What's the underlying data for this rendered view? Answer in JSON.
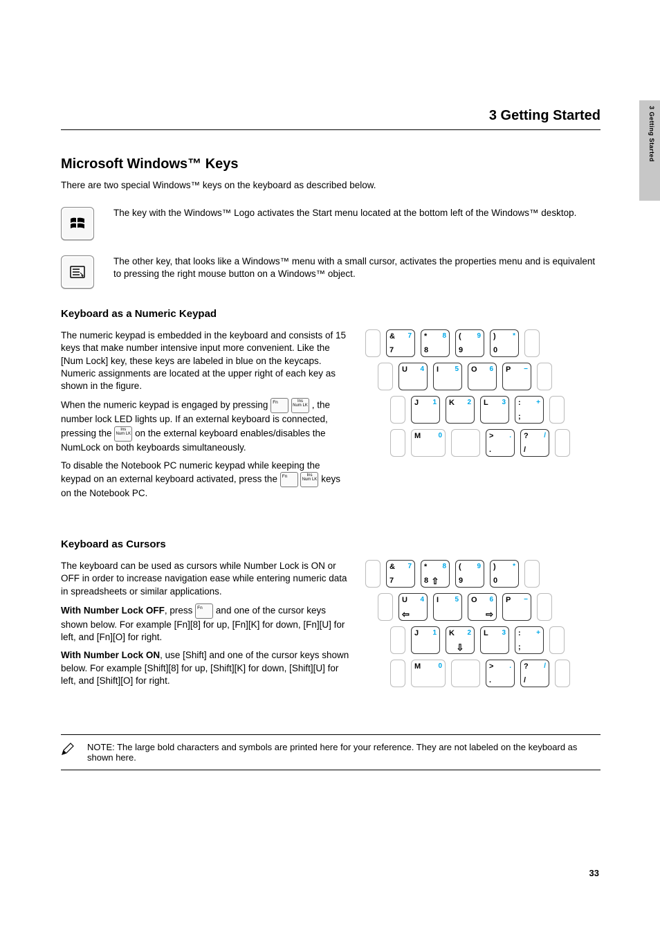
{
  "page_header": "3   Getting Started",
  "side_tab": "3   Getting Started",
  "page_number": "33",
  "winmenu": {
    "title": "Microsoft Windows™ Keys",
    "intro": "There are two special Windows™ keys on the keyboard as described below.",
    "items": [
      {
        "icon": "windows-logo-key",
        "text": "The key with the Windows™ Logo activates the Start menu located at the bottom left of the Windows™ desktop."
      },
      {
        "icon": "menu-key",
        "text": "The other key, that looks like a Windows™ menu with a small cursor, activates the properties menu and is equivalent to pressing the right mouse button on a Windows™ object."
      }
    ]
  },
  "numkeypad": {
    "title": "Keyboard as a Numeric Keypad",
    "p1": "The numeric keypad is embedded in the keyboard and consists of 15 keys that make number intensive input more convenient. Like the [Num Lock] key, these keys are labeled in blue on the keycaps. Numeric assignments are located at the upper right of each key as shown in the figure.",
    "p2_pre": "When the numeric keypad is engaged by pressing ",
    "p2_mid": ", the number lock LED lights up. If an external keyboard is connected, pressing the ",
    "p2_post": " on the external keyboard enables/disables the NumLock on both keyboards simultaneously.",
    "p3_pre": "To disable the Notebook PC numeric keypad while keeping the keypad on an external keyboard activated, press the ",
    "p3_post": " keys on the Notebook PC.",
    "fn_label": "Fn",
    "ins_label_line1": "Ins",
    "ins_label_line2": "Num LK"
  },
  "cursors": {
    "title": "Keyboard as Cursors",
    "p1": "The keyboard can be used as cursors while Number Lock is ON or OFF in order to increase navigation ease while entering numeric data in spreadsheets or similar applications.",
    "p2_pre": "With Number Lock OFF",
    "p2_mid": ", press ",
    "p2_post": " and one of the cursor keys shown below. For example [Fn][8] for up, [Fn][K] for down, [Fn][U] for left, and [Fn][O] for right.",
    "p3_pre": "With Number Lock ON",
    "p3_post": ", use [Shift] and one of the cursor keys shown below. For example [Shift][8] for up, [Shift][K] for down, [Shift][U] for left, and [Shift][O] for right."
  },
  "keypad_rows": {
    "r1": [
      {
        "main_top": "&",
        "num": "7",
        "main_bot": "7"
      },
      {
        "main_top": "*",
        "num": "8",
        "main_bot": "8"
      },
      {
        "main_top": "(",
        "num": "9",
        "main_bot": "9"
      },
      {
        "main_top": ")",
        "num": "*",
        "main_bot": "0"
      }
    ],
    "r2": [
      {
        "main_top": "U",
        "num": "4"
      },
      {
        "main_top": "I",
        "num": "5"
      },
      {
        "main_top": "O",
        "num": "6"
      },
      {
        "main_top": "P",
        "num": "−"
      }
    ],
    "r3": [
      {
        "main_top": "J",
        "num": "1"
      },
      {
        "main_top": "K",
        "num": "2"
      },
      {
        "main_top": "L",
        "num": "3"
      },
      {
        "main_top": ":",
        "num": "+",
        "main_bot": ";"
      }
    ],
    "r4": [
      {
        "main_top": "M",
        "num": "0"
      },
      {
        "main_top": ">",
        "num": ".",
        "main_bot": "."
      },
      {
        "main_top": "?",
        "num": "/",
        "main_bot": "/"
      }
    ]
  },
  "note": {
    "text": "NOTE: The large bold characters and symbols are printed here for your reference. They are not labeled on the keyboard as shown here."
  }
}
